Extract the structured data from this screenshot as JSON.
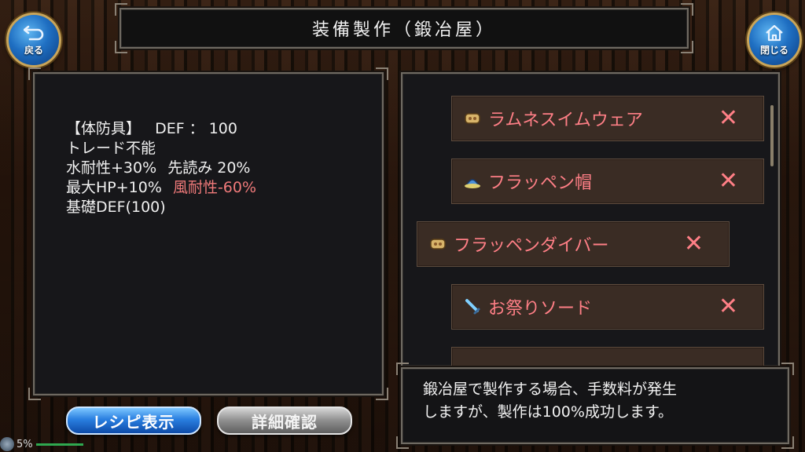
{
  "header": {
    "title": "装備製作（鍛冶屋）"
  },
  "nav": {
    "back_label": "戻る",
    "close_label": "閉じる"
  },
  "item_details": {
    "line1": {
      "category": "【体防具】",
      "stat": "DEF ： 100"
    },
    "line2": "トレード不能",
    "line3": {
      "a": "水耐性+30%",
      "b": "先読み 20%"
    },
    "line4": {
      "a": "最大HP+10%",
      "b": "風耐性-60%"
    },
    "line5": "基礎DEF(100)"
  },
  "recipe_list": [
    {
      "name": "ラムネスイムウェア",
      "icon": "armor-icon",
      "remove": "✕"
    },
    {
      "name": "フラッペン帽",
      "icon": "hat-icon",
      "remove": "✕"
    },
    {
      "name": "フラッペンダイバー",
      "icon": "armor-icon",
      "remove": "✕"
    },
    {
      "name": "お祭りソード",
      "icon": "sword-icon",
      "remove": "✕"
    }
  ],
  "message": {
    "line1": "鍛冶屋で製作する場合、手数料が発生",
    "line2": "しますが、製作は100%成功します。"
  },
  "buttons": {
    "recipe": "レシピ表示",
    "detail": "詳細確認"
  },
  "status": {
    "percent": "5%"
  },
  "colors": {
    "accent_red": "#ff7f86",
    "blue_button": "#2a7fe0"
  }
}
